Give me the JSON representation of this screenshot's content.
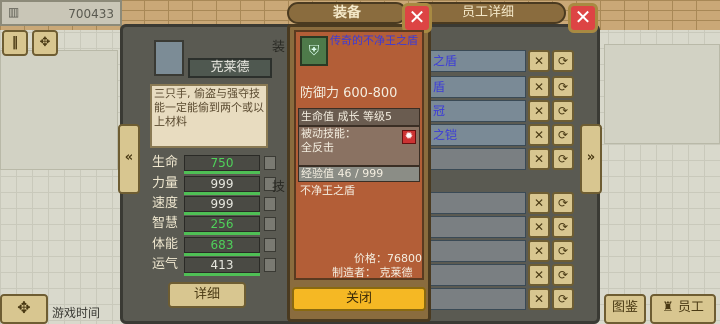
{
  "top_bar": {
    "money": "700433"
  },
  "employee_panel": {
    "title": "员工详细",
    "name": "克莱德",
    "description": "三只手, 偷盗与强夺技能一定能偷到两个或以上材料",
    "stats": [
      {
        "label": "生命",
        "value": "750",
        "highlight": true
      },
      {
        "label": "力量",
        "value": "999",
        "highlight": false
      },
      {
        "label": "速度",
        "value": "999",
        "highlight": false
      },
      {
        "label": "智慧",
        "value": "256",
        "highlight": true
      },
      {
        "label": "体能",
        "value": "683",
        "highlight": true
      },
      {
        "label": "运气",
        "value": "413",
        "highlight": false
      }
    ],
    "detail_button": "详细",
    "section_label_1": "装",
    "section_label_2": "技",
    "equipment_rows": [
      {
        "name": "之盾"
      },
      {
        "name": "盾"
      },
      {
        "name": "冠"
      },
      {
        "name": "之铠"
      },
      {
        "name": ""
      },
      {
        "name": ""
      },
      {
        "name": ""
      },
      {
        "name": ""
      },
      {
        "name": ""
      },
      {
        "name": ""
      }
    ]
  },
  "equipment_popup": {
    "title": "装备",
    "item_name": "传奇的不净王之盾",
    "defense": "防御力 600-800",
    "level_line": "生命值 成长 等级5",
    "skill_label": "被动技能：",
    "skill_name": "全反击",
    "exp": "经验值 46 / 999",
    "item_name_plain": "不净王之盾",
    "price": "价格：76800",
    "maker": "制造者： 克莱德",
    "close_label": "关闭"
  },
  "bottom_bar": {
    "game_time": "游戏时间",
    "map_label": "图鉴",
    "staff_label": "员工"
  },
  "colors": {
    "legend_blue": "#3b3bd8",
    "stat_green": "#4fd25a",
    "close_yellow": "#f5b824",
    "close_red": "#dd4444"
  },
  "icons": [
    "building-icon",
    "pause-icon",
    "settings-icon",
    "shield-icon",
    "skill-icon",
    "compass-icon",
    "close-icon",
    "swap-icon",
    "unequip-icon",
    "arrow-left-icon",
    "arrow-right-icon"
  ]
}
